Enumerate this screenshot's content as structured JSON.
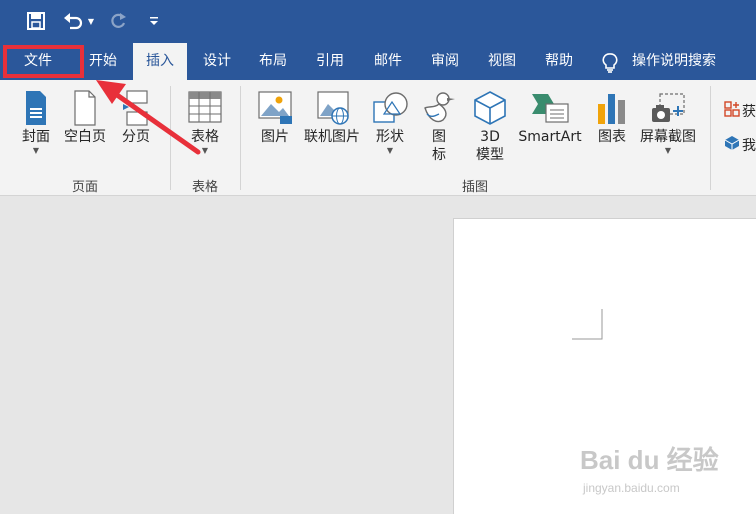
{
  "tabs": [
    {
      "label": "文件"
    },
    {
      "label": "开始"
    },
    {
      "label": "插入"
    },
    {
      "label": "设计"
    },
    {
      "label": "布局"
    },
    {
      "label": "引用"
    },
    {
      "label": "邮件"
    },
    {
      "label": "审阅"
    },
    {
      "label": "视图"
    },
    {
      "label": "帮助"
    }
  ],
  "search": {
    "label": "操作说明搜索"
  },
  "ribbon": {
    "pages_group": {
      "label": "页面",
      "cover": "封面",
      "blank": "空白页",
      "break": "分页"
    },
    "tables_group": {
      "label": "表格",
      "table": "表格"
    },
    "illustrations_group": {
      "label": "插图",
      "picture": "图片",
      "online_picture": "联机图片",
      "shapes": "形状",
      "icons_line1": "图",
      "icons_line2": "标",
      "model_line1": "3D",
      "model_line2": "模型",
      "smartart": "SmartArt",
      "chart": "图表",
      "screenshot": "屏幕截图"
    },
    "addins_group": {
      "get_addins_partial": "获",
      "my_addins_partial": "我"
    }
  },
  "watermark": {
    "main": "Bai du 经验",
    "sub": "jingyan.baidu.com"
  },
  "colors": {
    "accent": "#2b579a",
    "highlight": "#e8303a"
  }
}
